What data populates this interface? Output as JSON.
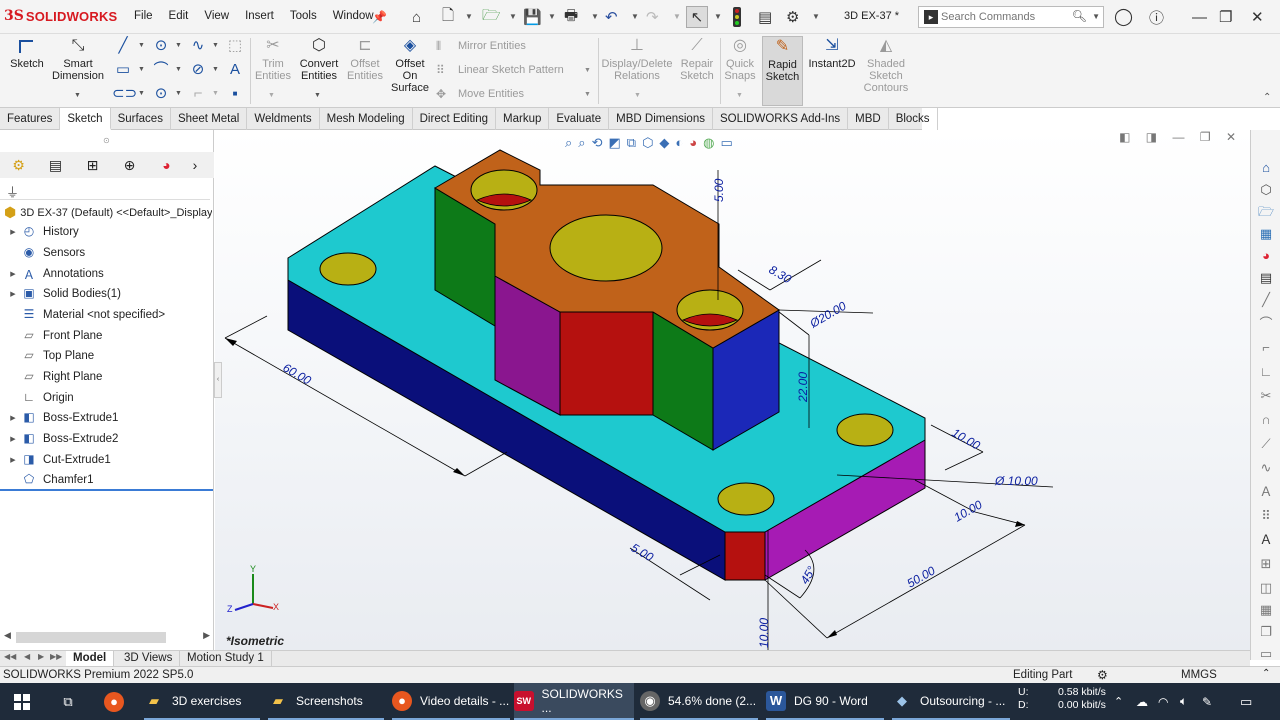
{
  "app": {
    "logo_ds": "3S",
    "logo_text": "SOLIDWORKS",
    "document_name": "3D EX-37 *"
  },
  "menus": [
    "File",
    "Edit",
    "View",
    "Insert",
    "Tools",
    "Window"
  ],
  "search": {
    "placeholder": "Search Commands"
  },
  "commands": {
    "sketch": "Sketch",
    "smart_dimension_1": "Smart",
    "smart_dimension_2": "Dimension",
    "trim_1": "Trim",
    "trim_2": "Entities",
    "convert_1": "Convert",
    "convert_2": "Entities",
    "offset_1": "Offset",
    "offset_2": "Entities",
    "offset_surface_1": "Offset",
    "offset_surface_2": "On",
    "offset_surface_3": "Surface",
    "mirror": "Mirror Entities",
    "linear_pattern": "Linear Sketch Pattern",
    "move": "Move Entities",
    "display_delete_1": "Display/Delete",
    "display_delete_2": "Relations",
    "repair_1": "Repair",
    "repair_2": "Sketch",
    "quick_snaps_1": "Quick",
    "quick_snaps_2": "Snaps",
    "rapid_1": "Rapid",
    "rapid_2": "Sketch",
    "instant2d": "Instant2D",
    "shaded_1": "Shaded",
    "shaded_2": "Sketch",
    "shaded_3": "Contours"
  },
  "tabs": [
    "Features",
    "Sketch",
    "Surfaces",
    "Sheet Metal",
    "Weldments",
    "Mesh Modeling",
    "Direct Editing",
    "Markup",
    "Evaluate",
    "MBD Dimensions",
    "SOLIDWORKS Add-Ins",
    "MBD",
    "Blocks"
  ],
  "active_tab": "Sketch",
  "tree": {
    "root": "3D EX-37 (Default) <<Default>_Display",
    "items": [
      {
        "label": "History",
        "icon": "history-icon",
        "expandable": true
      },
      {
        "label": "Sensors",
        "icon": "sensors-icon",
        "expandable": false
      },
      {
        "label": "Annotations",
        "icon": "annotations-icon",
        "expandable": true
      },
      {
        "label": "Solid Bodies(1)",
        "icon": "solid-bodies-icon",
        "expandable": true
      },
      {
        "label": "Material <not specified>",
        "icon": "material-icon",
        "expandable": false
      },
      {
        "label": "Front Plane",
        "icon": "plane-icon",
        "expandable": false
      },
      {
        "label": "Top Plane",
        "icon": "plane-icon",
        "expandable": false
      },
      {
        "label": "Right Plane",
        "icon": "plane-icon",
        "expandable": false
      },
      {
        "label": "Origin",
        "icon": "origin-icon",
        "expandable": false
      },
      {
        "label": "Boss-Extrude1",
        "icon": "extrude-icon",
        "expandable": true
      },
      {
        "label": "Boss-Extrude2",
        "icon": "extrude-icon",
        "expandable": true
      },
      {
        "label": "Cut-Extrude1",
        "icon": "cut-extrude-icon",
        "expandable": true
      },
      {
        "label": "Chamfer1",
        "icon": "chamfer-icon",
        "expandable": false
      }
    ]
  },
  "viewport": {
    "view_label": "*Isometric",
    "dimensions": {
      "d60": "60.00",
      "d5_top": "5.00",
      "d830": "8.30",
      "d20": "Ø20.00",
      "d22": "22.00",
      "d10a": "10.00",
      "d10dia": "Ø 10.00",
      "d10b": "10.00",
      "d50": "50.00",
      "d5_bottom": "5.00",
      "d45": "45°",
      "d10c": "10.00"
    },
    "colors": {
      "top": "#1ec9cf",
      "front": "#0a0f7a",
      "side": "#a61bb4",
      "boss_top": "#c0621a",
      "green": "#0d7a18",
      "purple": "#8a168f",
      "red": "#b5110f",
      "blue": "#1b28b8",
      "hole": "#b8b014",
      "dim": "#0a1ea0"
    }
  },
  "bottom_tabs": [
    "Model",
    "3D Views",
    "Motion Study 1"
  ],
  "status": {
    "left": "SOLIDWORKS Premium 2022 SP5.0",
    "mode": "Editing Part",
    "units": "MMGS"
  },
  "taskbar": {
    "items": [
      "3D exercises",
      "Screenshots",
      "Video details - ...",
      "SOLIDWORKS ...",
      "54.6% done (2...",
      "DG 90 - Word",
      "Outsourcing - ..."
    ],
    "net_u_label": "U:",
    "net_d_label": "D:",
    "net_up": "0.58 kbit/s",
    "net_down": "0.00 kbit/s"
  }
}
